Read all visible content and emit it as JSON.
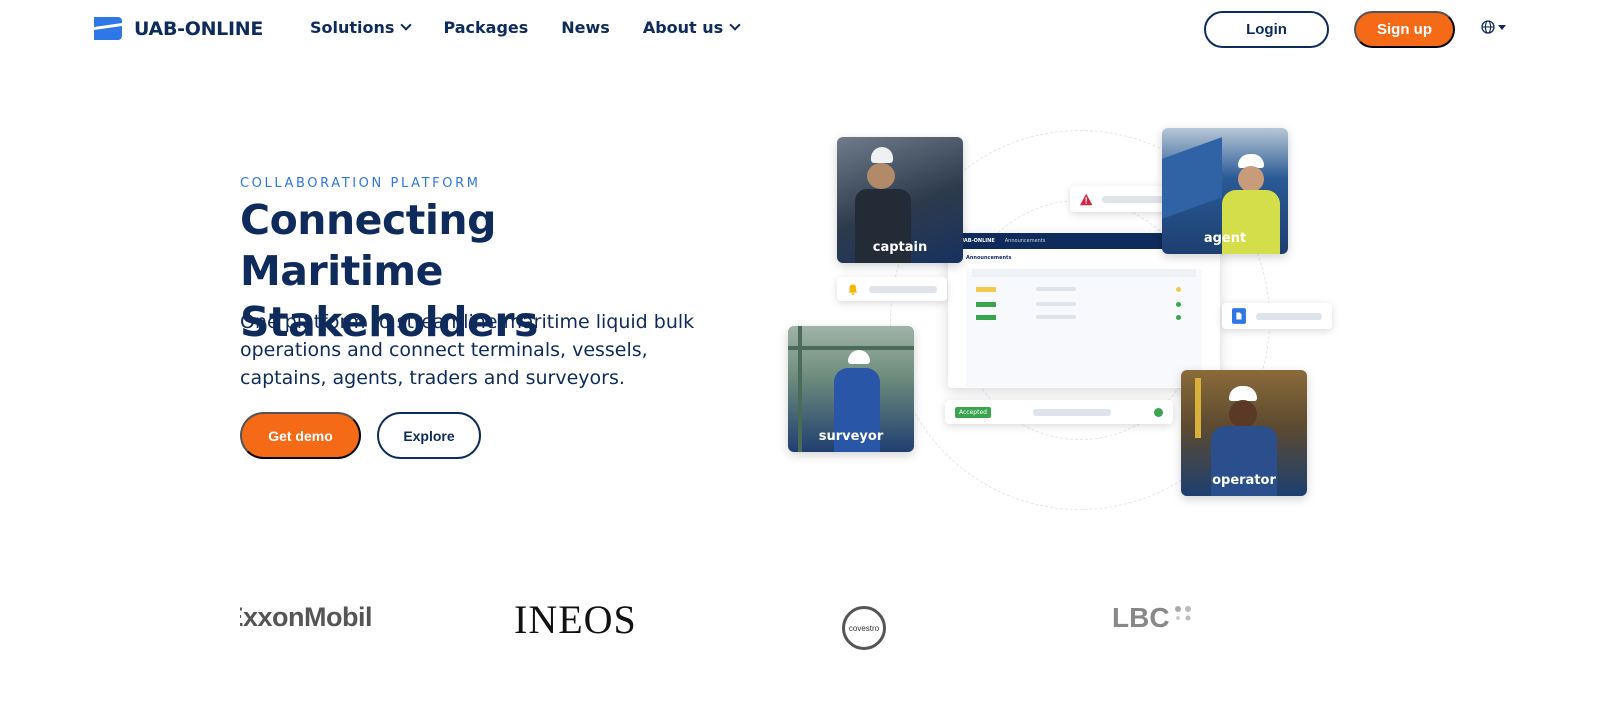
{
  "header": {
    "brand": "UAB-ONLINE",
    "nav": [
      {
        "label": "Solutions",
        "dropdown": true
      },
      {
        "label": "Packages",
        "dropdown": false
      },
      {
        "label": "News",
        "dropdown": false
      },
      {
        "label": "About us",
        "dropdown": true
      }
    ],
    "login_label": "Login",
    "signup_label": "Sign up",
    "language_icon": "globe-icon"
  },
  "hero": {
    "eyebrow": "COLLABORATION PLATFORM",
    "title": "Connecting Maritime Stakeholders",
    "description": "One platform to streamline maritime liquid bulk operations and connect terminals, vessels, captains, agents, traders and surveyors.",
    "demo_label": "Get demo",
    "explore_label": "Explore"
  },
  "illustration": {
    "roles": [
      "captain",
      "agent",
      "surveyor",
      "operator"
    ],
    "dashboard_brand": "UAB-ONLINE",
    "dashboard_tab": "Announcements",
    "dashboard_heading": "Announcements",
    "status_badge": "Accepted"
  },
  "partners": [
    "ExxonMobil",
    "INEOS",
    "covestro",
    "LBC"
  ],
  "colors": {
    "navy": "#0f2b5b",
    "orange": "#f46a17",
    "blue": "#2f76e6"
  }
}
